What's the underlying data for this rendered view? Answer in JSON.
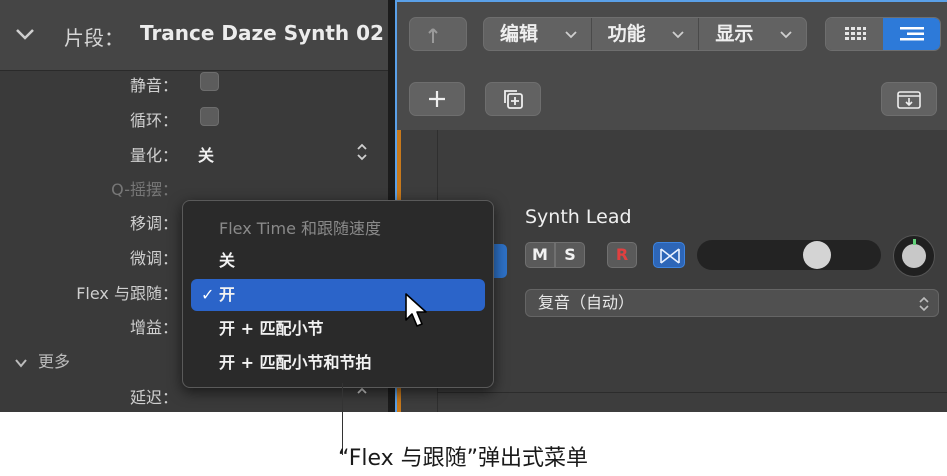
{
  "inspector": {
    "header": {
      "label": "片段：",
      "value": "Trance Daze Synth 02"
    },
    "rows": {
      "mute": "静音：",
      "loop": "循环：",
      "quantize": "量化：",
      "quantize_value": "关",
      "q_swing": "Q-摇摆：",
      "transpose": "移调：",
      "fine_tune": "微调：",
      "flex_follow": "Flex 与跟随：",
      "gain": "增益：",
      "delay": "延迟："
    },
    "more": "更多"
  },
  "toolbar": {
    "menus": [
      {
        "label": "编辑"
      },
      {
        "label": "功能"
      },
      {
        "label": "显示"
      }
    ],
    "view_active": "list"
  },
  "track": {
    "name": "Synth Lead",
    "mute_label": "M",
    "solo_label": "S",
    "record_label": "R",
    "volume_level": 0.68,
    "voice_mode": "复音（自动）"
  },
  "popup": {
    "title": "Flex Time 和跟随速度",
    "items": [
      {
        "label": "关",
        "selected": false
      },
      {
        "label": "开",
        "selected": true
      },
      {
        "label": "开 + 匹配小节",
        "selected": false
      },
      {
        "label": "开 + 匹配小节和节拍",
        "selected": false
      }
    ],
    "check_mark": "✓"
  },
  "callout": "“Flex 与跟随”弹出式菜单",
  "colors": {
    "accent": "#2b64c9",
    "record": "#e04040",
    "region": "#c7791c"
  }
}
